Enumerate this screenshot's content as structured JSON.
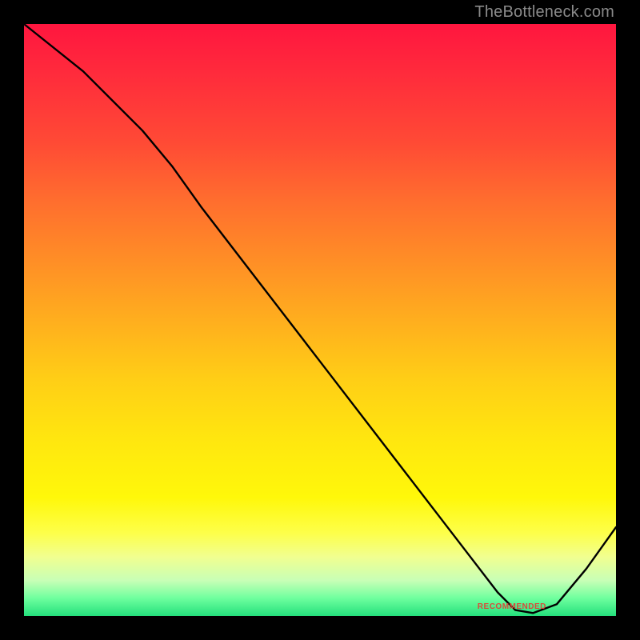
{
  "watermark": "TheBottleneck.com",
  "annotation_text": "RECOMMENDED",
  "chart_data": {
    "type": "line",
    "title": "",
    "xlabel": "",
    "ylabel": "",
    "xlim": [
      0,
      100
    ],
    "ylim": [
      0,
      100
    ],
    "grid": false,
    "series": [
      {
        "name": "curve",
        "x": [
          0,
          10,
          20,
          25,
          30,
          40,
          50,
          60,
          70,
          80,
          83,
          86,
          90,
          95,
          100
        ],
        "y": [
          100,
          92,
          82,
          76,
          69,
          56,
          43,
          30,
          17,
          4,
          1,
          0.5,
          2,
          8,
          15
        ]
      }
    ],
    "annotations": [
      {
        "text": "RECOMMENDED",
        "x": 82,
        "y": 1.5
      }
    ],
    "background_gradient": {
      "orientation": "vertical",
      "stops": [
        {
          "pos": 0.0,
          "color": "#ff163f"
        },
        {
          "pos": 0.5,
          "color": "#ffae1e"
        },
        {
          "pos": 0.8,
          "color": "#fff80a"
        },
        {
          "pos": 0.97,
          "color": "#6eff9e"
        },
        {
          "pos": 1.0,
          "color": "#24e07c"
        }
      ]
    }
  }
}
